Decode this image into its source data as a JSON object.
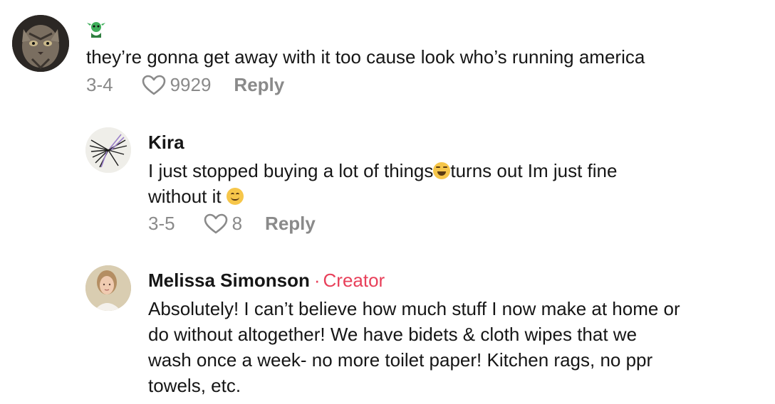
{
  "comments": [
    {
      "name": "",
      "name_emoji_icon": "goblin-emoji",
      "text": "they’re gonna get away with it too cause look who’s running america",
      "date": "3-4",
      "likes": "9929",
      "reply_label": "Reply"
    },
    {
      "name": "Kira",
      "text_part1": "I just stopped buying a lot of things",
      "text_part2": "turns out Im just fine",
      "text_part3": "without it ",
      "date": "3-5",
      "likes": "8",
      "reply_label": "Reply"
    },
    {
      "name": "Melissa Simonson",
      "creator_label": "Creator",
      "separator": "·",
      "text_lines": [
        "Absolutely! I can’t believe how much stuff I now make at home or",
        "do without altogether! We have bidets & cloth wipes that we",
        "wash once a week- no more toilet paper! Kitchen rags, no ppr",
        "towels, etc."
      ]
    }
  ],
  "colors": {
    "creator": "#e8405a",
    "meta": "#8a8a8a",
    "text": "#161616"
  }
}
